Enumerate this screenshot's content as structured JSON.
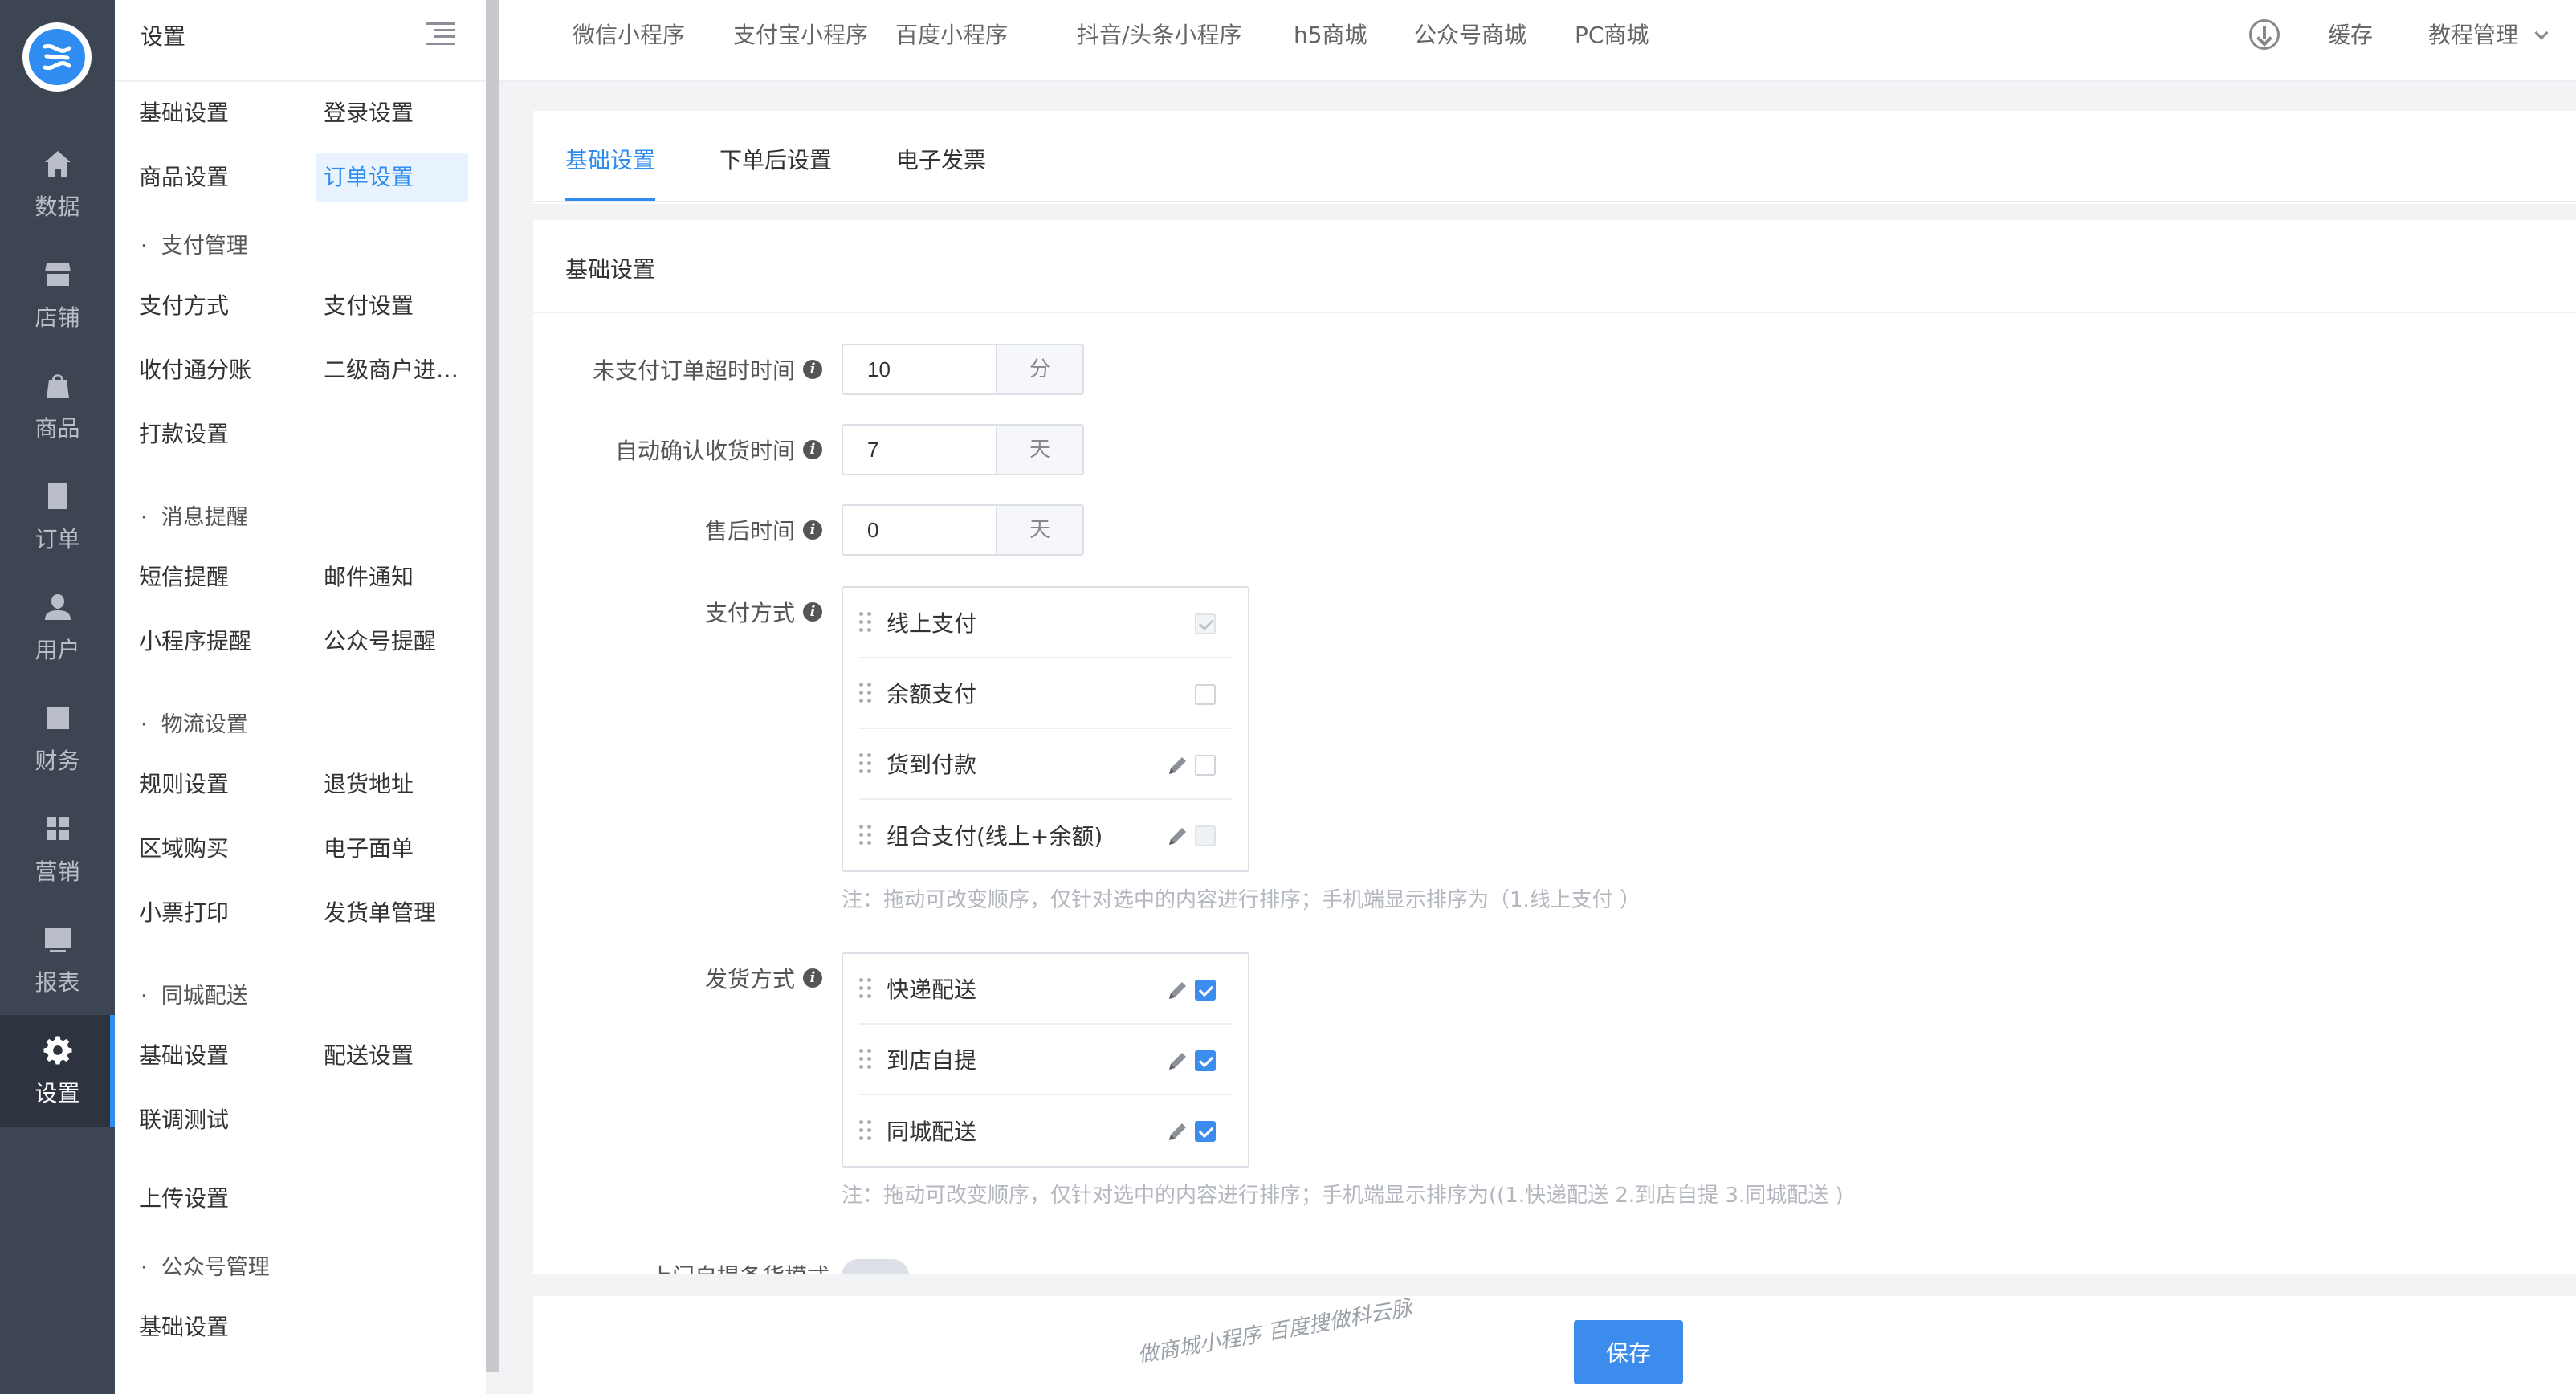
{
  "rail": {
    "items": [
      {
        "label": "数据",
        "icon": "home-icon"
      },
      {
        "label": "店铺",
        "icon": "store-icon"
      },
      {
        "label": "商品",
        "icon": "bag-icon"
      },
      {
        "label": "订单",
        "icon": "document-icon"
      },
      {
        "label": "用户",
        "icon": "user-icon"
      },
      {
        "label": "财务",
        "icon": "yen-icon"
      },
      {
        "label": "营销",
        "icon": "grid-icon"
      },
      {
        "label": "报表",
        "icon": "chart-icon"
      },
      {
        "label": "设置",
        "icon": "gear-icon"
      }
    ],
    "active": "设置"
  },
  "side": {
    "title": "设置",
    "rows": [
      [
        "基础设置",
        "登录设置"
      ],
      [
        "商品设置",
        "订单设置"
      ],
      [
        "支付管理"
      ],
      [
        "支付方式",
        "支付设置"
      ],
      [
        "收付通分账",
        "二级商户进…"
      ],
      [
        "打款设置"
      ],
      [
        "消息提醒"
      ],
      [
        "短信提醒",
        "邮件通知"
      ],
      [
        "小程序提醒",
        "公众号提醒"
      ],
      [
        "物流设置"
      ],
      [
        "规则设置",
        "退货地址"
      ],
      [
        "区域购买",
        "电子面单"
      ],
      [
        "小票打印",
        "发货单管理"
      ],
      [
        "同城配送"
      ],
      [
        "基础设置",
        "配送设置"
      ],
      [
        "联调测试"
      ],
      [
        "上传设置"
      ],
      [
        "公众号管理"
      ],
      [
        "基础设置"
      ]
    ]
  },
  "topbar": {
    "tabs": [
      "微信小程序",
      "支付宝小程序",
      "百度小程序",
      "抖音/头条小程序",
      "h5商城",
      "公众号商城",
      "PC商城"
    ],
    "cache": "缓存",
    "tutorial": "教程管理"
  },
  "panel": {
    "tabs": [
      "基础设置",
      "下单后设置",
      "电子发票"
    ],
    "section_title": "基础设置",
    "fields": [
      {
        "label": "未支付订单超时时间",
        "value": "10",
        "unit": "分"
      },
      {
        "label": "自动确认收货时间",
        "value": "7",
        "unit": "天"
      },
      {
        "label": "售后时间",
        "value": "0",
        "unit": "天"
      }
    ],
    "payment": {
      "label": "支付方式",
      "items": [
        {
          "name": "线上支付",
          "state": "disabled-checked",
          "editable": false
        },
        {
          "name": "余额支付",
          "state": "unchecked",
          "editable": false
        },
        {
          "name": "货到付款",
          "state": "unchecked",
          "editable": true
        },
        {
          "name": "组合支付(线上+余额)",
          "state": "disabled",
          "editable": true
        }
      ],
      "note": "注：拖动可改变顺序，仅针对选中的内容进行排序；手机端显示排序为（1.线上支付 ）"
    },
    "delivery": {
      "label": "发货方式",
      "items": [
        {
          "name": "快递配送",
          "state": "checked",
          "editable": true
        },
        {
          "name": "到店自提",
          "state": "checked",
          "editable": true
        },
        {
          "name": "同城配送",
          "state": "checked",
          "editable": true
        }
      ],
      "note": "注：拖动可改变顺序，仅针对选中的内容进行排序；手机端显示排序为((1.快递配送 2.到店自提 3.同城配送 )"
    },
    "partial_label": "上门自提备货模式"
  },
  "footer": {
    "save": "保存",
    "watermark": "做商城小程序  百度搜做科云脉"
  },
  "colors": {
    "accent": "#2f8cf0",
    "rail": "#3d4452",
    "checkbox": "#3b8ced"
  }
}
